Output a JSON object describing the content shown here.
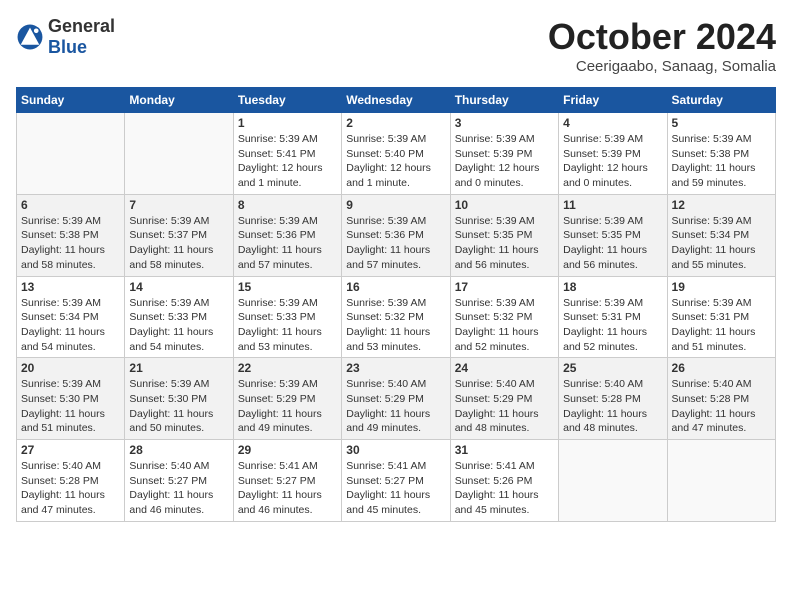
{
  "header": {
    "logo_general": "General",
    "logo_blue": "Blue",
    "month_title": "October 2024",
    "subtitle": "Ceerigaabo, Sanaag, Somalia"
  },
  "weekdays": [
    "Sunday",
    "Monday",
    "Tuesday",
    "Wednesday",
    "Thursday",
    "Friday",
    "Saturday"
  ],
  "weeks": [
    [
      {
        "day": "",
        "empty": true
      },
      {
        "day": "",
        "empty": true
      },
      {
        "day": "1",
        "sunrise": "Sunrise: 5:39 AM",
        "sunset": "Sunset: 5:41 PM",
        "daylight": "Daylight: 12 hours and 1 minute."
      },
      {
        "day": "2",
        "sunrise": "Sunrise: 5:39 AM",
        "sunset": "Sunset: 5:40 PM",
        "daylight": "Daylight: 12 hours and 1 minute."
      },
      {
        "day": "3",
        "sunrise": "Sunrise: 5:39 AM",
        "sunset": "Sunset: 5:39 PM",
        "daylight": "Daylight: 12 hours and 0 minutes."
      },
      {
        "day": "4",
        "sunrise": "Sunrise: 5:39 AM",
        "sunset": "Sunset: 5:39 PM",
        "daylight": "Daylight: 12 hours and 0 minutes."
      },
      {
        "day": "5",
        "sunrise": "Sunrise: 5:39 AM",
        "sunset": "Sunset: 5:38 PM",
        "daylight": "Daylight: 11 hours and 59 minutes."
      }
    ],
    [
      {
        "day": "6",
        "sunrise": "Sunrise: 5:39 AM",
        "sunset": "Sunset: 5:38 PM",
        "daylight": "Daylight: 11 hours and 58 minutes."
      },
      {
        "day": "7",
        "sunrise": "Sunrise: 5:39 AM",
        "sunset": "Sunset: 5:37 PM",
        "daylight": "Daylight: 11 hours and 58 minutes."
      },
      {
        "day": "8",
        "sunrise": "Sunrise: 5:39 AM",
        "sunset": "Sunset: 5:36 PM",
        "daylight": "Daylight: 11 hours and 57 minutes."
      },
      {
        "day": "9",
        "sunrise": "Sunrise: 5:39 AM",
        "sunset": "Sunset: 5:36 PM",
        "daylight": "Daylight: 11 hours and 57 minutes."
      },
      {
        "day": "10",
        "sunrise": "Sunrise: 5:39 AM",
        "sunset": "Sunset: 5:35 PM",
        "daylight": "Daylight: 11 hours and 56 minutes."
      },
      {
        "day": "11",
        "sunrise": "Sunrise: 5:39 AM",
        "sunset": "Sunset: 5:35 PM",
        "daylight": "Daylight: 11 hours and 56 minutes."
      },
      {
        "day": "12",
        "sunrise": "Sunrise: 5:39 AM",
        "sunset": "Sunset: 5:34 PM",
        "daylight": "Daylight: 11 hours and 55 minutes."
      }
    ],
    [
      {
        "day": "13",
        "sunrise": "Sunrise: 5:39 AM",
        "sunset": "Sunset: 5:34 PM",
        "daylight": "Daylight: 11 hours and 54 minutes."
      },
      {
        "day": "14",
        "sunrise": "Sunrise: 5:39 AM",
        "sunset": "Sunset: 5:33 PM",
        "daylight": "Daylight: 11 hours and 54 minutes."
      },
      {
        "day": "15",
        "sunrise": "Sunrise: 5:39 AM",
        "sunset": "Sunset: 5:33 PM",
        "daylight": "Daylight: 11 hours and 53 minutes."
      },
      {
        "day": "16",
        "sunrise": "Sunrise: 5:39 AM",
        "sunset": "Sunset: 5:32 PM",
        "daylight": "Daylight: 11 hours and 53 minutes."
      },
      {
        "day": "17",
        "sunrise": "Sunrise: 5:39 AM",
        "sunset": "Sunset: 5:32 PM",
        "daylight": "Daylight: 11 hours and 52 minutes."
      },
      {
        "day": "18",
        "sunrise": "Sunrise: 5:39 AM",
        "sunset": "Sunset: 5:31 PM",
        "daylight": "Daylight: 11 hours and 52 minutes."
      },
      {
        "day": "19",
        "sunrise": "Sunrise: 5:39 AM",
        "sunset": "Sunset: 5:31 PM",
        "daylight": "Daylight: 11 hours and 51 minutes."
      }
    ],
    [
      {
        "day": "20",
        "sunrise": "Sunrise: 5:39 AM",
        "sunset": "Sunset: 5:30 PM",
        "daylight": "Daylight: 11 hours and 51 minutes."
      },
      {
        "day": "21",
        "sunrise": "Sunrise: 5:39 AM",
        "sunset": "Sunset: 5:30 PM",
        "daylight": "Daylight: 11 hours and 50 minutes."
      },
      {
        "day": "22",
        "sunrise": "Sunrise: 5:39 AM",
        "sunset": "Sunset: 5:29 PM",
        "daylight": "Daylight: 11 hours and 49 minutes."
      },
      {
        "day": "23",
        "sunrise": "Sunrise: 5:40 AM",
        "sunset": "Sunset: 5:29 PM",
        "daylight": "Daylight: 11 hours and 49 minutes."
      },
      {
        "day": "24",
        "sunrise": "Sunrise: 5:40 AM",
        "sunset": "Sunset: 5:29 PM",
        "daylight": "Daylight: 11 hours and 48 minutes."
      },
      {
        "day": "25",
        "sunrise": "Sunrise: 5:40 AM",
        "sunset": "Sunset: 5:28 PM",
        "daylight": "Daylight: 11 hours and 48 minutes."
      },
      {
        "day": "26",
        "sunrise": "Sunrise: 5:40 AM",
        "sunset": "Sunset: 5:28 PM",
        "daylight": "Daylight: 11 hours and 47 minutes."
      }
    ],
    [
      {
        "day": "27",
        "sunrise": "Sunrise: 5:40 AM",
        "sunset": "Sunset: 5:28 PM",
        "daylight": "Daylight: 11 hours and 47 minutes."
      },
      {
        "day": "28",
        "sunrise": "Sunrise: 5:40 AM",
        "sunset": "Sunset: 5:27 PM",
        "daylight": "Daylight: 11 hours and 46 minutes."
      },
      {
        "day": "29",
        "sunrise": "Sunrise: 5:41 AM",
        "sunset": "Sunset: 5:27 PM",
        "daylight": "Daylight: 11 hours and 46 minutes."
      },
      {
        "day": "30",
        "sunrise": "Sunrise: 5:41 AM",
        "sunset": "Sunset: 5:27 PM",
        "daylight": "Daylight: 11 hours and 45 minutes."
      },
      {
        "day": "31",
        "sunrise": "Sunrise: 5:41 AM",
        "sunset": "Sunset: 5:26 PM",
        "daylight": "Daylight: 11 hours and 45 minutes."
      },
      {
        "day": "",
        "empty": true
      },
      {
        "day": "",
        "empty": true
      }
    ]
  ]
}
